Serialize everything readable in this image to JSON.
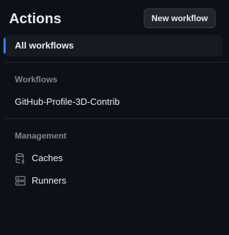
{
  "header": {
    "title": "Actions",
    "new_workflow_label": "New workflow"
  },
  "nav": {
    "all_workflows_label": "All workflows"
  },
  "workflows_section": {
    "title": "Workflows",
    "items": [
      {
        "label": "GitHub-Profile-3D-Contrib"
      }
    ]
  },
  "management_section": {
    "title": "Management",
    "items": [
      {
        "label": "Caches",
        "icon": "database-icon"
      },
      {
        "label": "Runners",
        "icon": "server-icon"
      }
    ]
  },
  "colors": {
    "background": "#0d1117",
    "accent": "#2f81f7",
    "text": "#e6edf3",
    "muted": "#7d8590"
  }
}
